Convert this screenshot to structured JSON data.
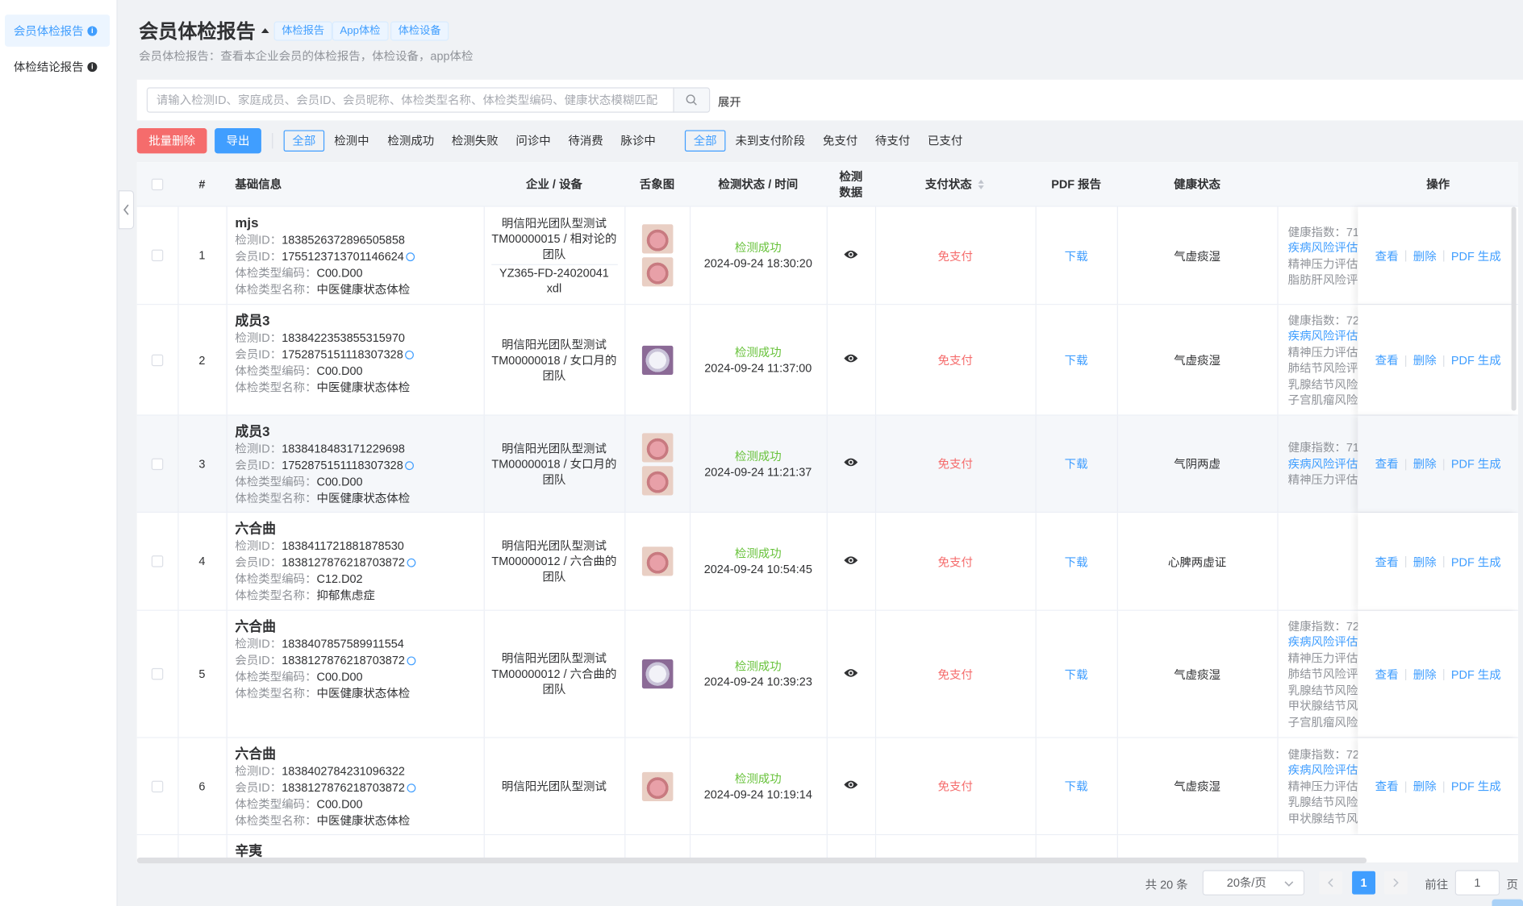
{
  "sidebar": {
    "items": [
      {
        "label": "会员体检报告",
        "info": "i"
      },
      {
        "label": "体检结论报告",
        "info": "i"
      }
    ]
  },
  "header": {
    "title": "会员体检报告",
    "tags": [
      "体检报告",
      "App体检",
      "体检设备"
    ],
    "subtitle": "会员体检报告：查看本企业会员的体检报告，体检设备，app体检"
  },
  "search": {
    "placeholder": "请输入检测ID、家庭成员、会员ID、会员昵称、体检类型名称、体检类型编码、健康状态模糊匹配",
    "value": "",
    "expand_label": "展开"
  },
  "toolbar": {
    "batch_delete_label": "批量删除",
    "export_label": "导出"
  },
  "filters": {
    "status": [
      "全部",
      "检测中",
      "检测成功",
      "检测失败",
      "问诊中",
      "待消费",
      "脉诊中"
    ],
    "status_selected": "全部",
    "payment": [
      "全部",
      "未到支付阶段",
      "免支付",
      "待支付",
      "已支付"
    ],
    "payment_selected": "全部"
  },
  "table": {
    "headers": {
      "index": "#",
      "basic": "基础信息",
      "company": "企业 / 设备",
      "tongue": "舌象图",
      "status": "检测状态 / 时间",
      "data": "检测数据",
      "pay": "支付状态",
      "pdf": "PDF 报告",
      "health": "健康状态",
      "ops": "操作"
    },
    "labels": {
      "detect_id": "检测ID：",
      "member_id": "会员ID：",
      "type_code": "体检类型编码：",
      "type_name": "体检类型名称："
    },
    "ops": {
      "view": "查看",
      "delete": "删除",
      "pdf": "PDF 生成",
      "divider": "|"
    },
    "pdf_link": "下载",
    "rows": [
      {
        "index": "1",
        "name": "mjs",
        "detect_id": "1838526372896505858",
        "member_id": "1755123713701146624",
        "type_code": "C00.D00",
        "type_name": "中医健康状态体检",
        "company": "明信阳光团队型测试TM00000015 / 相对论的团队",
        "device": "YZ365-FD-24020041 xdl",
        "status": "检测成功",
        "time": "2024-09-24 18:30:20",
        "pay": "免支付",
        "health": "气虚痰湿",
        "risks": [
          "健康指数：71",
          "疾病风险评估",
          "精神压力评估",
          "脂肪肝风险评"
        ]
      },
      {
        "index": "2",
        "name": "成员3",
        "detect_id": "1838422353855315970",
        "member_id": "1752875151118307328",
        "type_code": "C00.D00",
        "type_name": "中医健康状态体检",
        "company": "明信阳光团队型测试TM00000018 / 女口月的团队",
        "device": "",
        "status": "检测成功",
        "time": "2024-09-24 11:37:00",
        "pay": "免支付",
        "health": "气虚痰湿",
        "risks": [
          "健康指数：72",
          "疾病风险评估",
          "精神压力评估",
          "肺结节风险评",
          "乳腺结节风险",
          "子宫肌瘤风险"
        ]
      },
      {
        "index": "3",
        "name": "成员3",
        "detect_id": "1838418483171229698",
        "member_id": "1752875151118307328",
        "type_code": "C00.D00",
        "type_name": "中医健康状态体检",
        "company": "明信阳光团队型测试TM00000018 / 女口月的团队",
        "device": "",
        "status": "检测成功",
        "time": "2024-09-24 11:21:37",
        "pay": "免支付",
        "health": "气阴两虚",
        "risks": [
          "健康指数：71",
          "疾病风险评估",
          "精神压力评估"
        ]
      },
      {
        "index": "4",
        "name": "六合曲",
        "detect_id": "1838411721881878530",
        "member_id": "1838127876218703872",
        "type_code": "C12.D02",
        "type_name": "抑郁焦虑症",
        "company": "明信阳光团队型测试TM00000012 / 六合曲的团队",
        "device": "",
        "status": "检测成功",
        "time": "2024-09-24 10:54:45",
        "pay": "免支付",
        "health": "心脾两虚证",
        "risks": []
      },
      {
        "index": "5",
        "name": "六合曲",
        "detect_id": "1838407857589911554",
        "member_id": "1838127876218703872",
        "type_code": "C00.D00",
        "type_name": "中医健康状态体检",
        "company": "明信阳光团队型测试TM00000012 / 六合曲的团队",
        "device": "",
        "status": "检测成功",
        "time": "2024-09-24 10:39:23",
        "pay": "免支付",
        "health": "气虚痰湿",
        "risks": [
          "健康指数：72",
          "疾病风险评估",
          "精神压力评估",
          "肺结节风险评",
          "乳腺结节风险",
          "甲状腺结节风",
          "子宫肌瘤风险"
        ]
      },
      {
        "index": "6",
        "name": "六合曲",
        "detect_id": "1838402784231096322",
        "member_id": "1838127876218703872",
        "type_code": "C00.D00",
        "type_name": "中医健康状态体检",
        "company": "明信阳光团队型测试",
        "device": "",
        "status": "检测成功",
        "time": "2024-09-24 10:19:14",
        "pay": "免支付",
        "health": "气虚痰湿",
        "risks": [
          "健康指数：72",
          "疾病风险评估",
          "精神压力评估",
          "乳腺结节风险",
          "甲状腺结节风"
        ]
      },
      {
        "index": "",
        "name": "辛夷",
        "detect_id": "",
        "member_id": "",
        "type_code": "",
        "type_name": "",
        "company": "",
        "device": "",
        "status": "",
        "time": "",
        "pay": "",
        "health": "",
        "risks": []
      }
    ]
  },
  "pagination": {
    "total": "共 20 条",
    "page_size": "20条/页",
    "current": "1",
    "goto_label": "前往",
    "goto_value": "1",
    "page_suffix": "页"
  }
}
